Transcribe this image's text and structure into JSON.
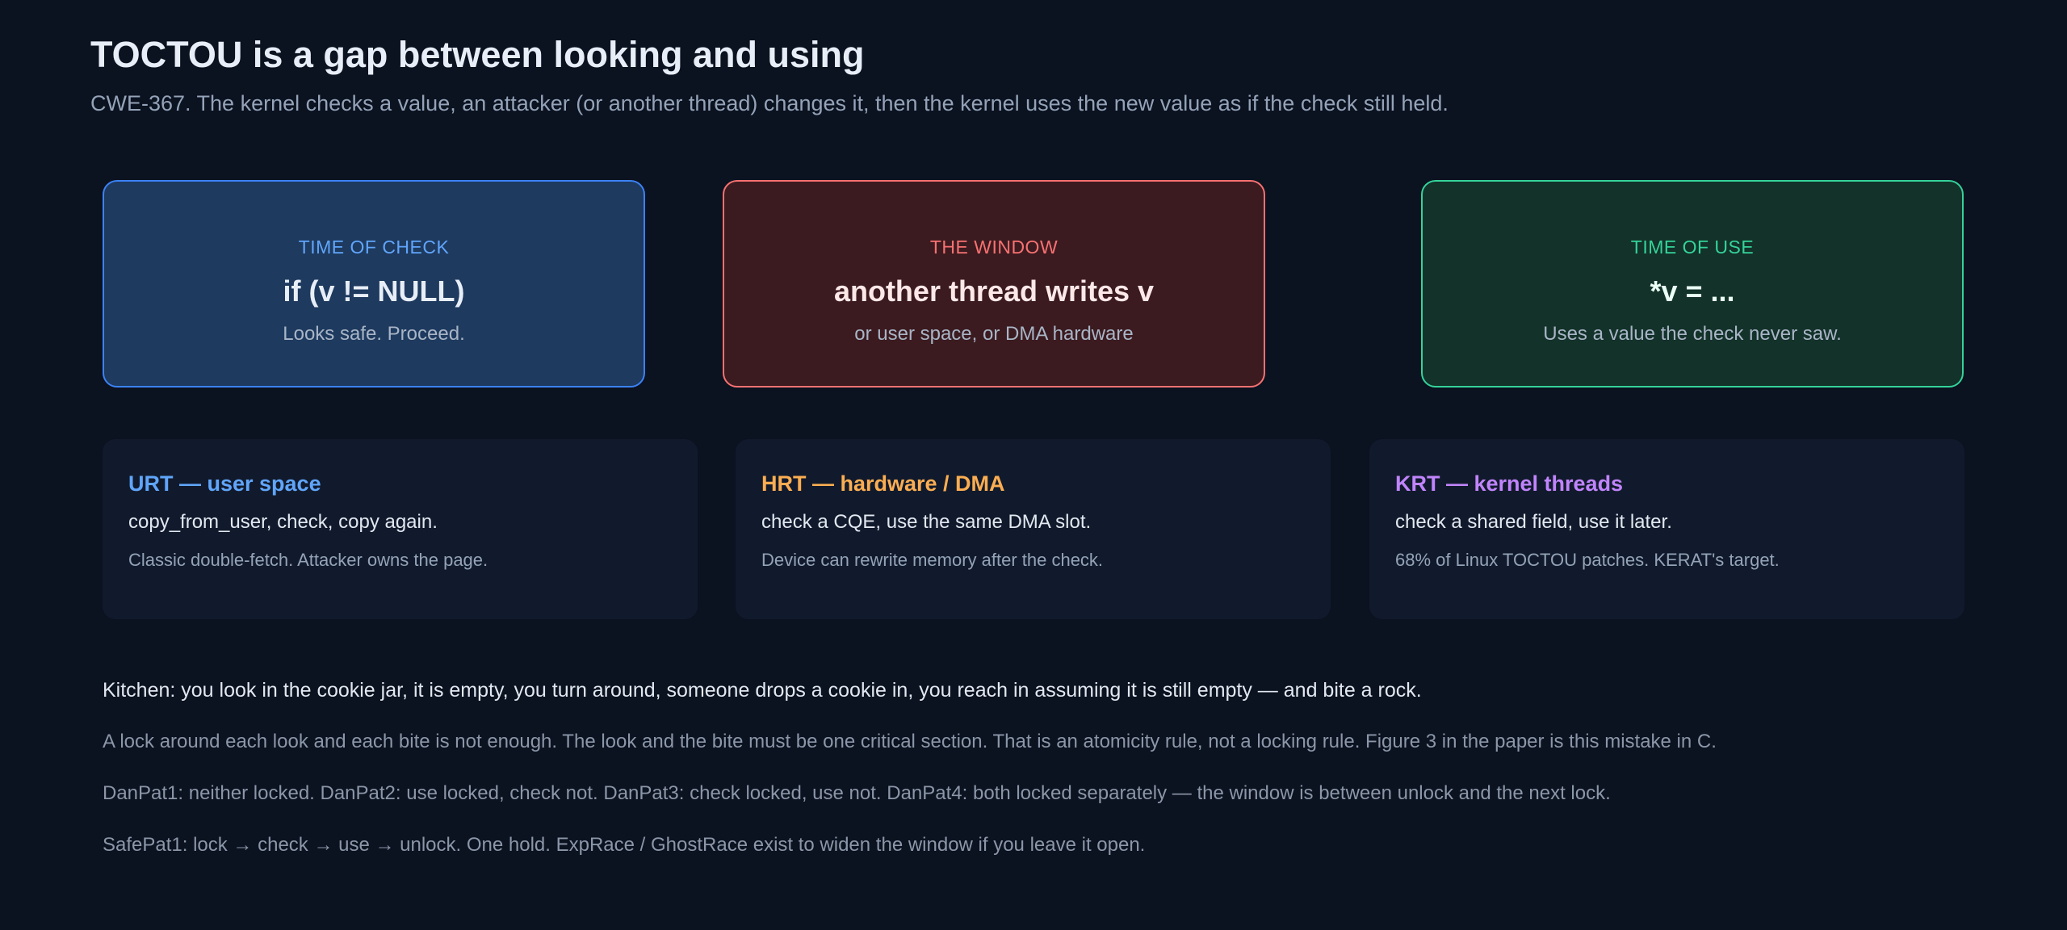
{
  "header": {
    "title": "TOCTOU is a gap between looking and using",
    "subtitle": "CWE-367. The kernel checks a value, an attacker (or another thread) changes it, then the kernel uses the new value as if the check still held."
  },
  "phases": [
    {
      "label": "TIME OF CHECK",
      "code": "if (v != NULL)",
      "note": "Looks safe. Proceed.",
      "color": "#3b82f6"
    },
    {
      "label": "THE WINDOW",
      "code": "another thread writes v",
      "note": "or user space, or DMA hardware",
      "color": "#f87171"
    },
    {
      "label": "TIME OF USE",
      "code": "*v = ...",
      "note": "Uses a value the check never saw.",
      "color": "#34d399"
    }
  ],
  "types": [
    {
      "title": "URT — user space",
      "main": "copy_from_user, check, copy again.",
      "sub": "Classic double-fetch. Attacker owns the page.",
      "color": "#60a5fa"
    },
    {
      "title": "HRT — hardware / DMA",
      "main": "check a CQE, use the same DMA slot.",
      "sub": "Device can rewrite memory after the check.",
      "color": "#fbad52"
    },
    {
      "title": "KRT — kernel threads",
      "main": "check a shared field, use it later.",
      "sub": "68% of Linux TOCTOU patches. KERAT's target.",
      "color": "#c084fc"
    }
  ],
  "notes": {
    "lead": "Kitchen: you look in the cookie jar, it is empty, you turn around, someone drops a cookie in, you reach in assuming it is still empty — and bite a rock.",
    "paragraphs": [
      "A lock around each look and each bite is not enough. The look and the bite must be one critical section. That is an atomicity rule, not a locking rule. Figure 3 in the paper is this mistake in C.",
      "DanPat1: neither locked. DanPat2: use locked, check not. DanPat3: check locked, use not. DanPat4: both locked separately — the window is between unlock and the next lock.",
      "SafePat1: lock → check → use → unlock. One hold. ExpRace / GhostRace exist to widen the window if you leave it open."
    ]
  }
}
